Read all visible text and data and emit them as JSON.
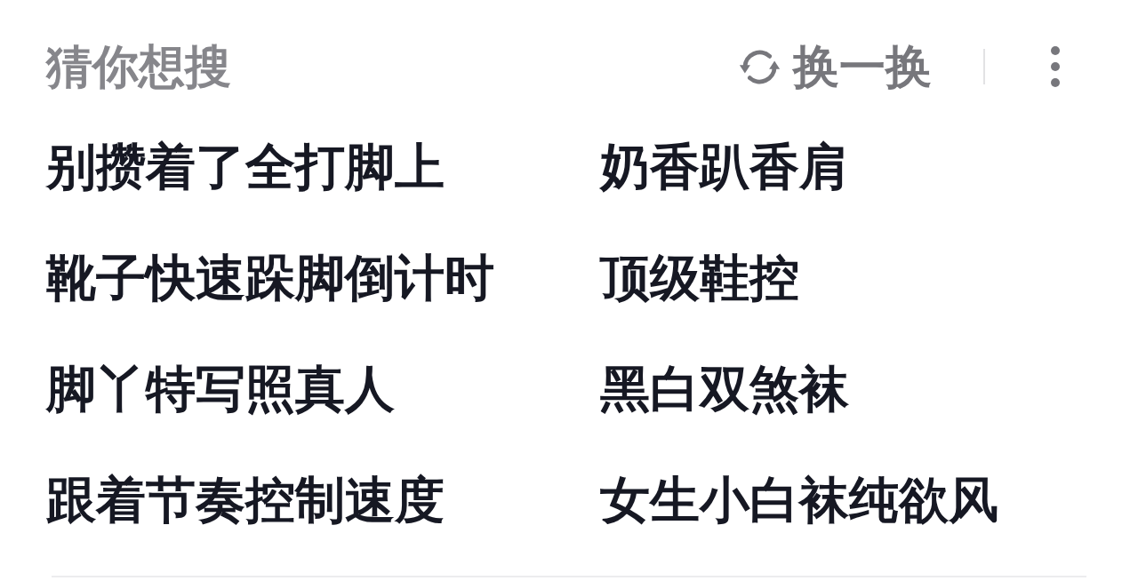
{
  "header": {
    "title": "猜你想搜",
    "refresh_label": "换一换"
  },
  "suggestions": [
    "别攒着了全打脚上",
    "奶香趴香肩",
    "靴子快速跺脚倒计时",
    "顶级鞋控",
    "脚丫特写照真人",
    "黑白双煞袜",
    "跟着节奏控制速度",
    "女生小白袜纯欲风"
  ]
}
